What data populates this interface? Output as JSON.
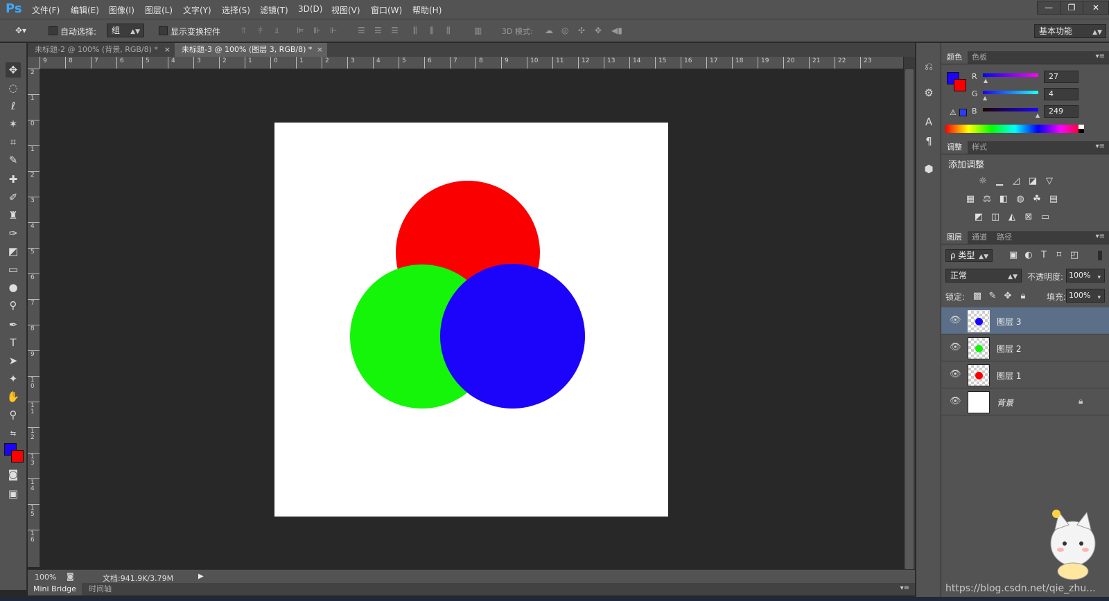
{
  "app": {
    "logo": "Ps",
    "menu": [
      "文件(F)",
      "编辑(E)",
      "图像(I)",
      "图层(L)",
      "文字(Y)",
      "选择(S)",
      "滤镜(T)",
      "3D(D)",
      "视图(V)",
      "窗口(W)",
      "帮助(H)"
    ],
    "window_buttons": [
      "—",
      "❐",
      "✕"
    ]
  },
  "options": {
    "auto_select_label": "自动选择:",
    "auto_select_value": "组",
    "transform_label": "显示变换控件",
    "mode3d_label": "3D 模式:",
    "workspace": "基本功能"
  },
  "tabs": [
    {
      "label": "未标题-2 @ 100% (背景, RGB/8) *",
      "close": "×"
    },
    {
      "label": "未标题-3 @ 100% (图层 3, RGB/8) *",
      "close": "×"
    }
  ],
  "rulers": {
    "h": [
      "9",
      "8",
      "7",
      "6",
      "5",
      "4",
      "3",
      "2",
      "1",
      "0",
      "1",
      "2",
      "3",
      "4",
      "5",
      "6",
      "7",
      "8",
      "9",
      "10",
      "11",
      "12",
      "13",
      "14",
      "15",
      "16",
      "17",
      "18",
      "19",
      "20",
      "21",
      "22",
      "23"
    ],
    "v": [
      "2",
      "1",
      "0",
      "1",
      "2",
      "3",
      "4",
      "5",
      "6",
      "7",
      "8",
      "9",
      "10",
      "11",
      "12",
      "13",
      "14",
      "15",
      "16"
    ]
  },
  "canvas": {
    "circles": [
      {
        "name": "red",
        "color": "#fa0000"
      },
      {
        "name": "green",
        "color": "#14f50a"
      },
      {
        "name": "blue",
        "color": "#1b04f9"
      }
    ]
  },
  "status": {
    "zoom": "100%",
    "doc_info": "文档:941.9K/3.79M",
    "bottom_tabs": [
      "Mini Bridge",
      "时间轴"
    ]
  },
  "color_panel": {
    "tabs": [
      "颜色",
      "色板"
    ],
    "fg": "#1b04f9",
    "bg": "#fa0000",
    "channels": [
      {
        "label": "R",
        "value": "27"
      },
      {
        "label": "G",
        "value": "4"
      },
      {
        "label": "B",
        "value": "249"
      }
    ]
  },
  "adjust_panel": {
    "tabs": [
      "调整",
      "样式"
    ],
    "title": "添加调整"
  },
  "layers_panel": {
    "tabs": [
      "图层",
      "通道",
      "路径"
    ],
    "filter_label": "ρ 类型",
    "blend_mode": "正常",
    "opacity_label": "不透明度:",
    "opacity_value": "100%",
    "lock_label": "锁定:",
    "fill_label": "填充:",
    "fill_value": "100%",
    "layers": [
      {
        "name": "图层 3",
        "dot": "#1b04f9",
        "selected": true
      },
      {
        "name": "图层 2",
        "dot": "#14f50a",
        "selected": false
      },
      {
        "name": "图层 1",
        "dot": "#fa0000",
        "selected": false
      },
      {
        "name": "背景",
        "dot": "",
        "selected": false
      }
    ]
  },
  "watermark": "https://blog.csdn.net/qie_zhu..."
}
